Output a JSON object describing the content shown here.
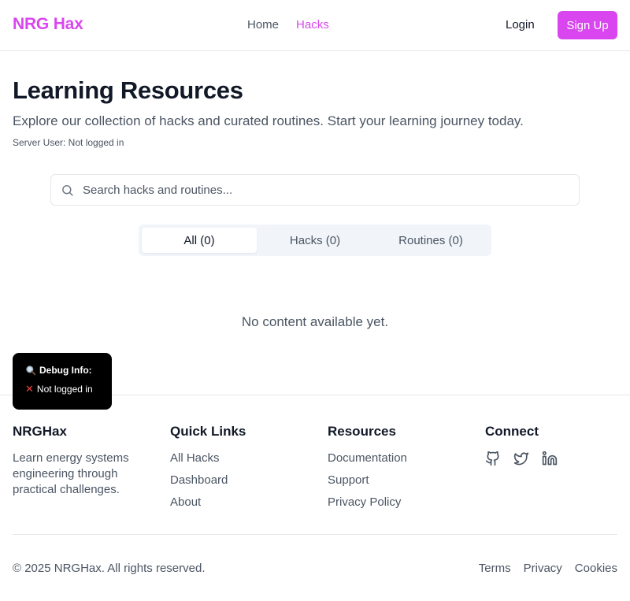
{
  "header": {
    "logo": "NRG Hax",
    "nav": [
      {
        "label": "Home",
        "active": false
      },
      {
        "label": "Hacks",
        "active": true
      }
    ],
    "login_label": "Login",
    "signup_label": "Sign Up"
  },
  "main": {
    "title": "Learning Resources",
    "subtitle": "Explore our collection of hacks and curated routines. Start your learning journey today.",
    "server_user": "Server User: Not logged in",
    "search": {
      "placeholder": "Search hacks and routines...",
      "value": ""
    },
    "tabs": [
      {
        "label": "All (0)",
        "active": true
      },
      {
        "label": "Hacks (0)",
        "active": false
      },
      {
        "label": "Routines (0)",
        "active": false
      }
    ],
    "empty_message": "No content available yet."
  },
  "debug": {
    "title": "Debug Info:",
    "status": "Not logged in"
  },
  "footer": {
    "brand": {
      "name": "NRGHax",
      "description": "Learn energy systems engineering through practical challenges."
    },
    "quick_links": {
      "title": "Quick Links",
      "items": [
        "All Hacks",
        "Dashboard",
        "About"
      ]
    },
    "resources": {
      "title": "Resources",
      "items": [
        "Documentation",
        "Support",
        "Privacy Policy"
      ]
    },
    "connect": {
      "title": "Connect",
      "icons": [
        "github-icon",
        "twitter-icon",
        "linkedin-icon"
      ]
    },
    "copyright": "© 2025 NRGHax. All rights reserved.",
    "legal_links": [
      "Terms",
      "Privacy",
      "Cookies"
    ]
  },
  "colors": {
    "brand": "#d946ef",
    "text_primary": "#111827",
    "text_muted": "#4b5563",
    "border": "#e5e7eb",
    "tab_bg": "#f1f5f9"
  }
}
